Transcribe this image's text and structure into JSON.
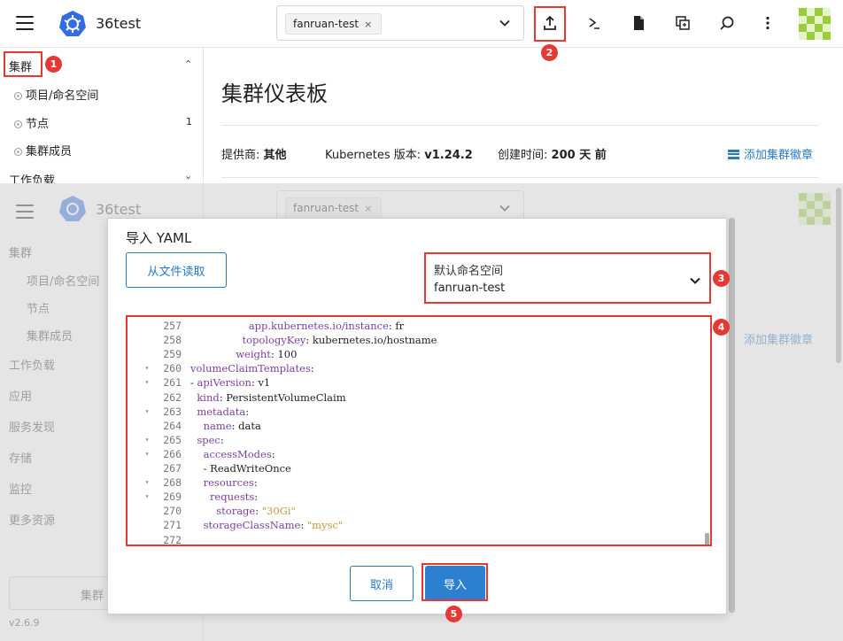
{
  "header": {
    "cluster_name": "36test",
    "namespace_chip": "fanruan-test",
    "chip_remove": "×"
  },
  "sidebar": {
    "cluster_group": "集群",
    "items": [
      {
        "label": "项目/命名空间",
        "count": ""
      },
      {
        "label": "节点",
        "count": "1"
      },
      {
        "label": "集群成员",
        "count": ""
      }
    ],
    "workload_group": "工作负载"
  },
  "main": {
    "title": "集群仪表板",
    "provider_label": "提供商:",
    "provider_value": "其他",
    "k8s_label": "Kubernetes 版本:",
    "k8s_value": "v1.24.2",
    "created_label": "创建时间:",
    "created_value": "200 天 前",
    "add_badge": "添加集群徽章"
  },
  "ghost": {
    "cluster_name": "36test",
    "namespace_chip": "fanruan-test",
    "nav": [
      "集群",
      "项目/命名空间",
      "节点",
      "集群成员",
      "工作负载",
      "应用",
      "服务发现",
      "存储",
      "监控",
      "更多资源"
    ],
    "tools_btn": "集群",
    "version": "v2.6.9",
    "add_badge": "添加集群徽章"
  },
  "modal": {
    "title": "导入 YAML",
    "read_file": "从文件读取",
    "default_ns_label": "默认命名空间",
    "default_ns_value": "fanruan-test",
    "cancel": "取消",
    "import": "导入"
  },
  "editor": {
    "lines": [
      {
        "n": "257",
        "fold": "",
        "indent": "                  ",
        "key": "app.kubernetes.io/instance",
        "sep": ": ",
        "val": "fr",
        "str": false
      },
      {
        "n": "258",
        "fold": "",
        "indent": "                ",
        "key": "topologyKey",
        "sep": ": ",
        "val": "kubernetes.io/hostname",
        "str": false
      },
      {
        "n": "259",
        "fold": "",
        "indent": "              ",
        "key": "weight",
        "sep": ": ",
        "val": "100",
        "str": false
      },
      {
        "n": "260",
        "fold": "▾",
        "indent": "",
        "key": "volumeClaimTemplates",
        "sep": ":",
        "val": "",
        "str": false
      },
      {
        "n": "261",
        "fold": "▾",
        "indent": "- ",
        "key": "apiVersion",
        "sep": ": ",
        "val": "v1",
        "str": false
      },
      {
        "n": "262",
        "fold": "",
        "indent": "  ",
        "key": "kind",
        "sep": ": ",
        "val": "PersistentVolumeClaim",
        "str": false
      },
      {
        "n": "263",
        "fold": "▾",
        "indent": "  ",
        "key": "metadata",
        "sep": ":",
        "val": "",
        "str": false
      },
      {
        "n": "264",
        "fold": "",
        "indent": "    ",
        "key": "name",
        "sep": ": ",
        "val": "data",
        "str": false
      },
      {
        "n": "265",
        "fold": "▾",
        "indent": "  ",
        "key": "spec",
        "sep": ":",
        "val": "",
        "str": false
      },
      {
        "n": "266",
        "fold": "▾",
        "indent": "    ",
        "key": "accessModes",
        "sep": ":",
        "val": "",
        "str": false
      },
      {
        "n": "267",
        "fold": "",
        "indent": "    - ",
        "key": "",
        "sep": "",
        "val": "ReadWriteOnce",
        "str": false
      },
      {
        "n": "268",
        "fold": "▾",
        "indent": "    ",
        "key": "resources",
        "sep": ":",
        "val": "",
        "str": false
      },
      {
        "n": "269",
        "fold": "▾",
        "indent": "      ",
        "key": "requests",
        "sep": ":",
        "val": "",
        "str": false
      },
      {
        "n": "270",
        "fold": "",
        "indent": "        ",
        "key": "storage",
        "sep": ": ",
        "val": "\"30Gi\"",
        "str": true
      },
      {
        "n": "271",
        "fold": "",
        "indent": "    ",
        "key": "storageClassName",
        "sep": ": ",
        "val": "\"mysc\"",
        "str": true
      },
      {
        "n": "272",
        "fold": "",
        "indent": "",
        "key": "",
        "sep": "",
        "val": "",
        "str": false
      }
    ]
  },
  "annotations": [
    "1",
    "2",
    "3",
    "4",
    "5"
  ],
  "colors": {
    "accent": "#2d7fcf",
    "highlight": "#e53935",
    "yaml_key": "#7b3fa3",
    "yaml_string": "#c69a3a"
  }
}
